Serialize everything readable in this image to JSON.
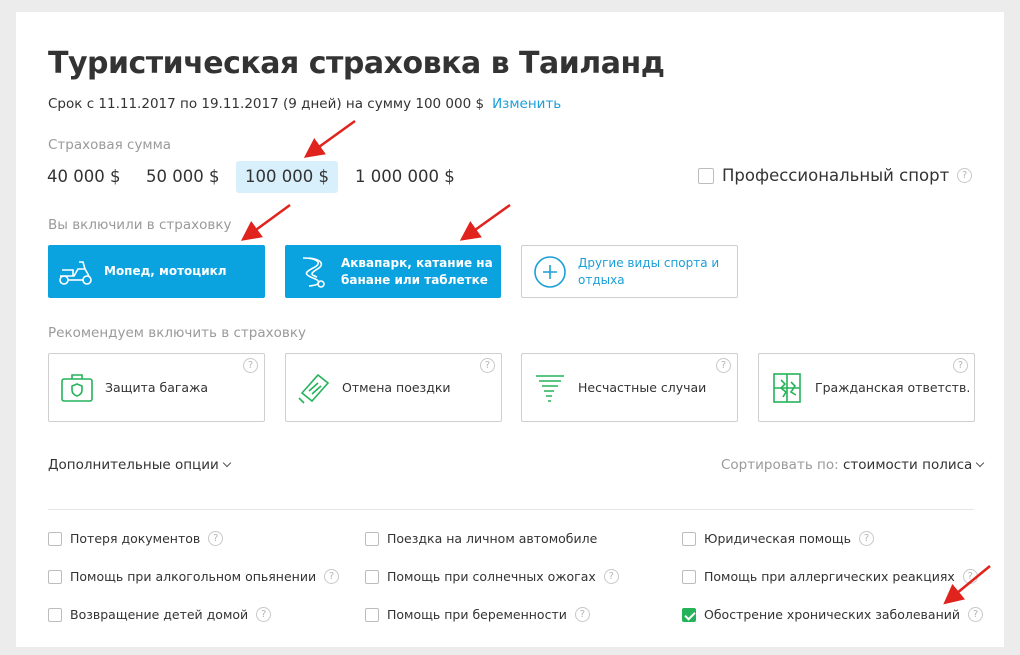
{
  "header": {
    "title": "Туристическая страховка в Таиланд",
    "period": "Срок с 11.11.2017 по 19.11.2017 (9 дней) на сумму 100 000 $",
    "change_label": "Изменить"
  },
  "sum_section": {
    "label": "Страховая сумма",
    "options": [
      "40 000 $",
      "50 000 $",
      "100 000 $",
      "1 000 000 $"
    ],
    "selected": "100 000 $",
    "pro_sport_label": "Профессиональный спорт",
    "pro_sport_checked": false
  },
  "included": {
    "label": "Вы включили в страховку",
    "items": [
      {
        "label": "Мопед, мотоцикл",
        "icon": "moped-icon",
        "active": true
      },
      {
        "label_line1": "Аквапарк, катание на",
        "label_line2": "банане или таблетке",
        "icon": "waterslide-icon",
        "active": true
      },
      {
        "label_line1": "Другие виды спорта и",
        "label_line2": "отдыха",
        "icon": "plus-circle-icon",
        "active": false
      }
    ]
  },
  "recommended": {
    "label": "Рекомендуем включить в страховку",
    "items": [
      {
        "label": "Защита багажа",
        "icon": "luggage-icon"
      },
      {
        "label": "Отмена поездки",
        "icon": "ticket-icon"
      },
      {
        "label": "Несчастные случаи",
        "icon": "tornado-icon"
      },
      {
        "label": "Гражданская ответств.",
        "icon": "broken-window-icon"
      }
    ]
  },
  "options_bar": {
    "extra_label": "Дополнительные опции",
    "sort_label": "Сортировать по:",
    "sort_value": "стоимости полиса"
  },
  "extra_options": {
    "col1": [
      {
        "label": "Потеря документов",
        "checked": false
      },
      {
        "label": "Помощь при алкогольном опьянении",
        "checked": false
      },
      {
        "label": "Возвращение детей домой",
        "checked": false
      }
    ],
    "col2": [
      {
        "label": "Поездка на личном автомобиле",
        "checked": false
      },
      {
        "label": "Помощь при солнечных ожогах",
        "checked": false
      },
      {
        "label": "Помощь при беременности",
        "checked": false
      }
    ],
    "col3": [
      {
        "label": "Юридическая помощь",
        "checked": false
      },
      {
        "label": "Помощь при аллергических реакциях",
        "checked": false
      },
      {
        "label": "Обострение хронических заболеваний",
        "checked": true
      }
    ]
  },
  "help_symbol": "?",
  "colors": {
    "accent": "#0aa3df",
    "link": "#1b9fd8",
    "icon_green": "#25b35a",
    "arrow": "#e0231d"
  }
}
